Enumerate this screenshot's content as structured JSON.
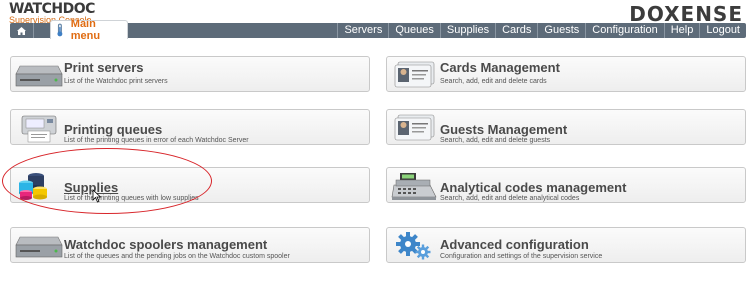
{
  "header": {
    "logo_main": "WATCHDOC",
    "logo_sub": "Supervision Console",
    "brand": "DOXENSE"
  },
  "menu": {
    "home_icon": "home-icon",
    "main_tab_label": "Main menu",
    "items": [
      "Servers",
      "Queues",
      "Supplies",
      "Cards",
      "Guests",
      "Configuration",
      "Help",
      "Logout"
    ]
  },
  "cards": {
    "print_servers": {
      "title": "Print servers",
      "desc": "List of the Watchdoc print servers",
      "icon": "print-server-icon"
    },
    "cards_management": {
      "title": "Cards Management",
      "desc": "Search, add, edit and delete cards",
      "icon": "id-cards-icon"
    },
    "printing_queues": {
      "title": "Printing queues",
      "desc": "List of the printing queues in error of each Watchdoc Server",
      "icon": "printer-icon"
    },
    "guests_management": {
      "title": "Guests Management",
      "desc": "Search, add, edit and delete guests",
      "icon": "id-cards-icon"
    },
    "supplies": {
      "title": "Supplies",
      "desc": "List of the printing queues with low supplies",
      "icon": "toner-supplies-icon"
    },
    "analytical_codes": {
      "title": "Analytical codes management",
      "desc": "Search, add, edit and delete analytical codes",
      "icon": "cash-register-icon"
    },
    "spoolers": {
      "title": "Watchdoc spoolers management",
      "desc": "List of the queues and the pending jobs on the Watchdoc custom spooler",
      "icon": "server-icon"
    },
    "advanced_config": {
      "title": "Advanced configuration",
      "desc": "Configuration and settings of the supervision service",
      "icon": "gears-icon"
    }
  },
  "colors": {
    "menubar": "#5d6b79",
    "accent_orange": "#e06c12",
    "highlight_red": "#d8262b"
  }
}
